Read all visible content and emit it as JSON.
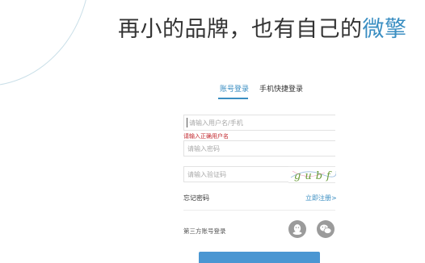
{
  "headline": {
    "main": "再小的品牌，也有自己的",
    "accent": "微擎"
  },
  "tabs": [
    {
      "label": "账号登录",
      "active": true
    },
    {
      "label": "手机快捷登录",
      "active": false
    }
  ],
  "form": {
    "username_placeholder": "请输入用户名/手机",
    "username_error": "请输入正确用户名",
    "password_placeholder": "请输入密码",
    "captcha_placeholder": "请输入验证码",
    "captcha_text": "gubf"
  },
  "links": {
    "forgot": "忘记密码",
    "register": "立即注册>"
  },
  "third_party": {
    "label": "第三方账号登录",
    "icons": [
      "qq-icon",
      "wechat-icon"
    ]
  },
  "colors": {
    "accent": "#3a8ec2",
    "error": "#c2272d",
    "button": "#4a96d2"
  }
}
